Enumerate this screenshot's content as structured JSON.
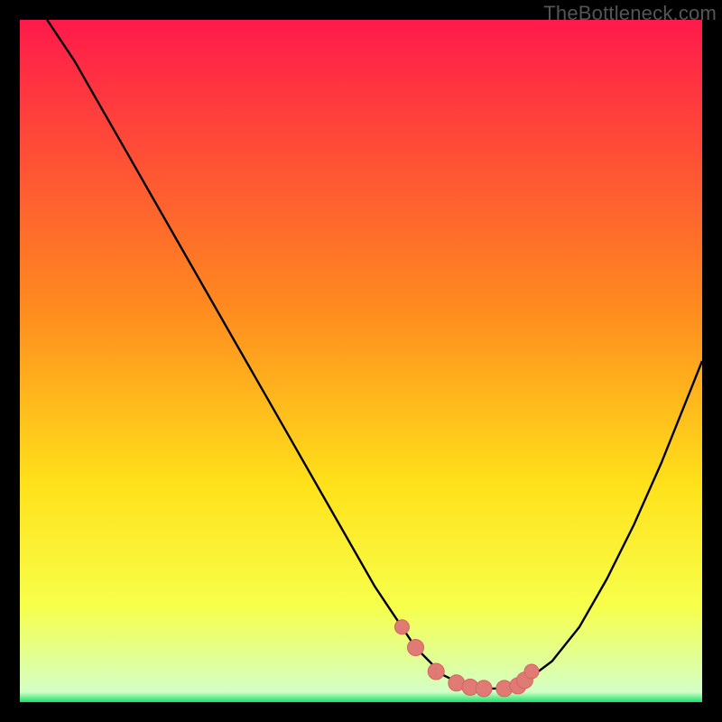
{
  "watermark": "TheBottleneck.com",
  "colors": {
    "curve": "#000000",
    "marker_fill": "#e07a74",
    "marker_stroke": "#d4665f",
    "gradient_top": "#ff1a4b",
    "gradient_mid1": "#ff8a1f",
    "gradient_mid2": "#ffe11a",
    "gradient_mid3": "#f7ff4b",
    "gradient_bottom": "#18e06a"
  },
  "chart_data": {
    "type": "line",
    "title": "",
    "xlabel": "",
    "ylabel": "",
    "xlim": [
      0,
      100
    ],
    "ylim": [
      0,
      100
    ],
    "series": [
      {
        "name": "bottleneck-curve",
        "x": [
          4,
          8,
          12,
          16,
          20,
          24,
          28,
          32,
          36,
          40,
          44,
          48,
          52,
          54,
          56,
          58,
          60,
          62,
          64,
          66,
          68,
          70,
          72,
          74,
          78,
          82,
          86,
          90,
          94,
          98,
          100
        ],
        "y": [
          100,
          94,
          87,
          80,
          73,
          66,
          59,
          52,
          45,
          38,
          31,
          24,
          17,
          14,
          11,
          8,
          6,
          4,
          3,
          2,
          2,
          2,
          2,
          3,
          6,
          11,
          18,
          26,
          35,
          45,
          50
        ]
      }
    ],
    "markers": {
      "name": "optimal-region",
      "x": [
        56,
        58,
        61,
        64,
        66,
        68,
        71,
        73,
        74,
        75
      ],
      "y": [
        11,
        8,
        4.5,
        2.8,
        2.2,
        2.0,
        2.0,
        2.4,
        3.2,
        4.5
      ]
    }
  }
}
